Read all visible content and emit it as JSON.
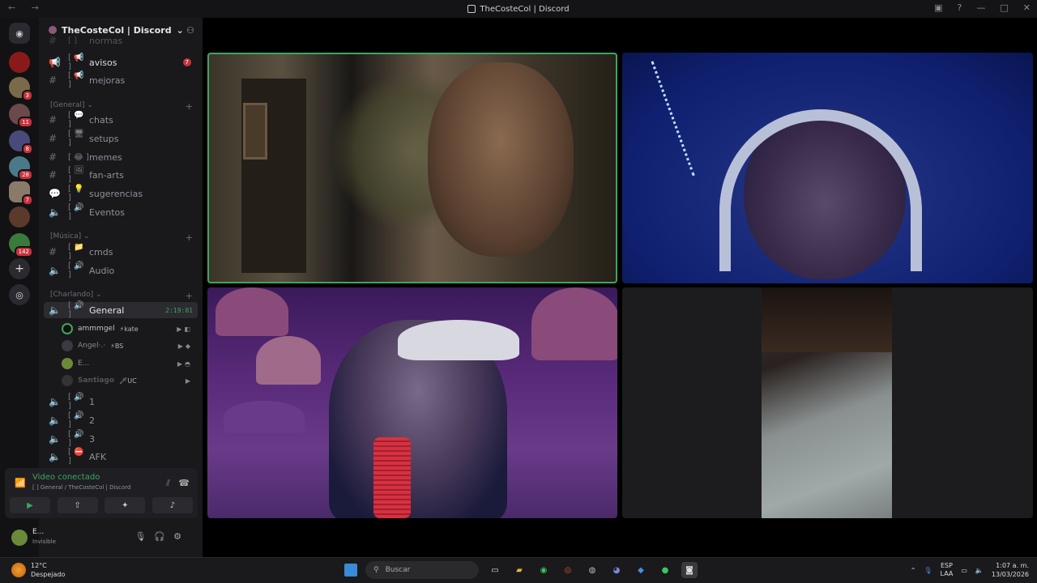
{
  "window": {
    "title": "TheCosteCol | Discord"
  },
  "guild": {
    "name": "TheCosteCol | Discord"
  },
  "servers": [
    {
      "badge": ""
    },
    {
      "badge": "3"
    },
    {
      "badge": "11"
    },
    {
      "badge": "8"
    },
    {
      "badge": "28"
    },
    {
      "badge": "7"
    },
    {
      "badge": ""
    },
    {
      "badge": "142"
    }
  ],
  "channels": {
    "top_partial": "normas",
    "avisos": {
      "label": "avisos",
      "count": "7"
    },
    "mejoras": "mejoras",
    "cat_general": "[General]",
    "chats": "chats",
    "setups": "setups",
    "memes": "memes",
    "fanarts": "fan-arts",
    "sugerencias": "sugerencias",
    "eventos": "Eventos",
    "cat_musica": "[Música]",
    "cmds": "cmds",
    "audio": "Audio",
    "cat_charlando": "[Charlando]",
    "general_voice": {
      "label": "General",
      "timer": "2:19:01"
    },
    "v1": "1",
    "v2": "2",
    "v3": "3",
    "afk": "AFK"
  },
  "voice_users": [
    {
      "name": "ammmgel",
      "tag": "⚡kate"
    },
    {
      "name": "Angel·.·",
      "tag": "⚡BS"
    },
    {
      "name": "E...",
      "tag": ""
    },
    {
      "name": "Santiago",
      "tag": "🗡UC"
    }
  ],
  "voice_panel": {
    "status": "Video conectado",
    "location": "[ ] General / TheCosteCol | Discord"
  },
  "user": {
    "name": "E...",
    "status": "Invisible"
  },
  "taskbar": {
    "temp": "12°C",
    "weather": "Despejado",
    "search_placeholder": "Buscar",
    "lang1": "ESP",
    "lang2": "LAA",
    "time": "1:07 a. m.",
    "date": "13/03/2026"
  },
  "colors": {
    "accent_green": "#3fa561",
    "badge_red": "#c8323c"
  }
}
